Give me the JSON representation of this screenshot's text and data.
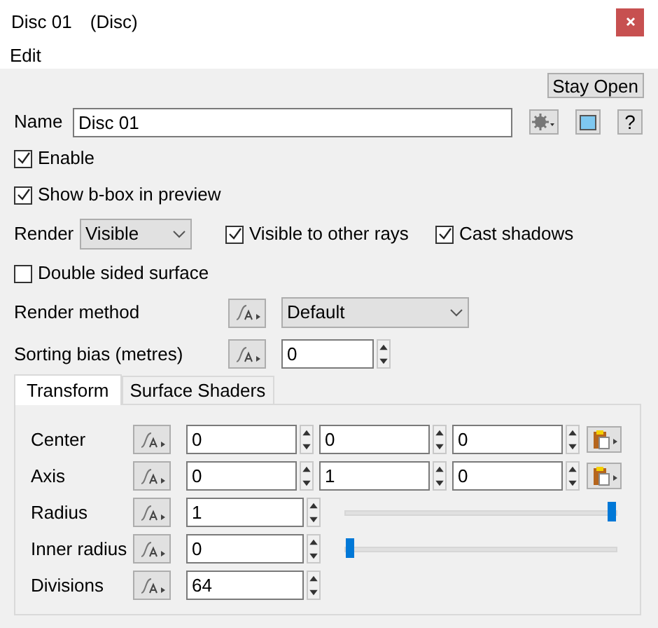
{
  "window": {
    "title": "Disc 01",
    "subtitle": "(Disc)"
  },
  "menu": [
    "Edit"
  ],
  "stay_open_button": "Stay Open",
  "name_field": {
    "label": "Name",
    "value": "Disc 01"
  },
  "help_button": "?",
  "enable": {
    "label": "Enable",
    "checked": true
  },
  "show_bbox": {
    "label": "Show b-box in preview",
    "checked": true
  },
  "render": {
    "label": "Render",
    "value": "Visible"
  },
  "visible_to_rays": {
    "label": "Visible to other rays",
    "checked": true
  },
  "cast_shadows": {
    "label": "Cast shadows",
    "checked": true
  },
  "double_sided": {
    "label": "Double sided surface",
    "checked": false
  },
  "render_method": {
    "label": "Render method",
    "value": "Default"
  },
  "sorting_bias": {
    "label": "Sorting bias (metres)",
    "value": "0"
  },
  "tabs": [
    {
      "label": "Transform",
      "selected": true
    },
    {
      "label": "Surface Shaders",
      "selected": false
    }
  ],
  "rows": [
    {
      "kind": "vector",
      "label": "Center",
      "values": [
        "0",
        "0",
        "0"
      ]
    },
    {
      "kind": "vector",
      "label": "Axis",
      "values": [
        "0",
        "1",
        "0"
      ]
    },
    {
      "kind": "slider",
      "label": "Radius",
      "value": "1",
      "level": 1
    },
    {
      "kind": "slider",
      "label": "Inner radius",
      "value": "0",
      "level": 0
    },
    {
      "kind": "number",
      "label": "Divisions",
      "value": "64"
    }
  ]
}
